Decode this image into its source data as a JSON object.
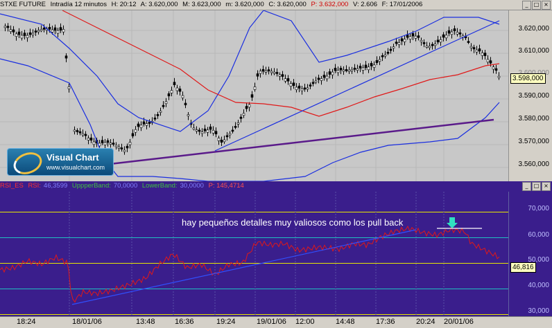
{
  "header": {
    "symbol": "STXE FUTURE",
    "interval": "Intradía 12 minutos",
    "h": "H: 20:12",
    "a": "A: 3.620,000",
    "m1": "M: 3.623,000",
    "m2": "m: 3.620,000",
    "c": "C: 3.620,000",
    "p": "P: 3.632,000",
    "v": "V: 2.606",
    "f": "F: 17/01/2006"
  },
  "price_axis": {
    "ticks": [
      "3.620,000",
      "3.610,000",
      "3.600,000",
      "3.590,000",
      "3.580,000",
      "3.570,000",
      "3.560,000"
    ],
    "current": "3.598,000"
  },
  "logo": {
    "title": "Visual Chart",
    "url": "www.visualchart.com"
  },
  "rsi_header": {
    "rsi_label": "RSI_ES",
    "rsi_name": "RSI:",
    "rsi_value": "46,3599",
    "upper_label": "UppperBand:",
    "upper_value": "70,0000",
    "lower_label": "LowerBand:",
    "lower_value": "30,0000",
    "p_value": "P: 145,4714"
  },
  "rsi_axis": {
    "ticks": [
      "70,000",
      "60,000",
      "50,000",
      "40,000",
      "30,000"
    ],
    "current": "46,816"
  },
  "annotation": "hay pequeños detalles muy valiosos como los pull back",
  "time_axis": [
    "18:24",
    "18/01/06",
    "13:48",
    "16:36",
    "19:24",
    "19/01/06",
    "12:00",
    "14:48",
    "17:36",
    "20:24",
    "20/01/06"
  ],
  "colors": {
    "price_bg": "#c8c8c8",
    "rsi_bg": "#3a1e8c",
    "upper_band": "#1a2ee0",
    "middle_band": "#e01818",
    "trendline": "#5a1a8a",
    "rsi_line": "#e01818",
    "rsi_band": "#20e0e0"
  }
}
